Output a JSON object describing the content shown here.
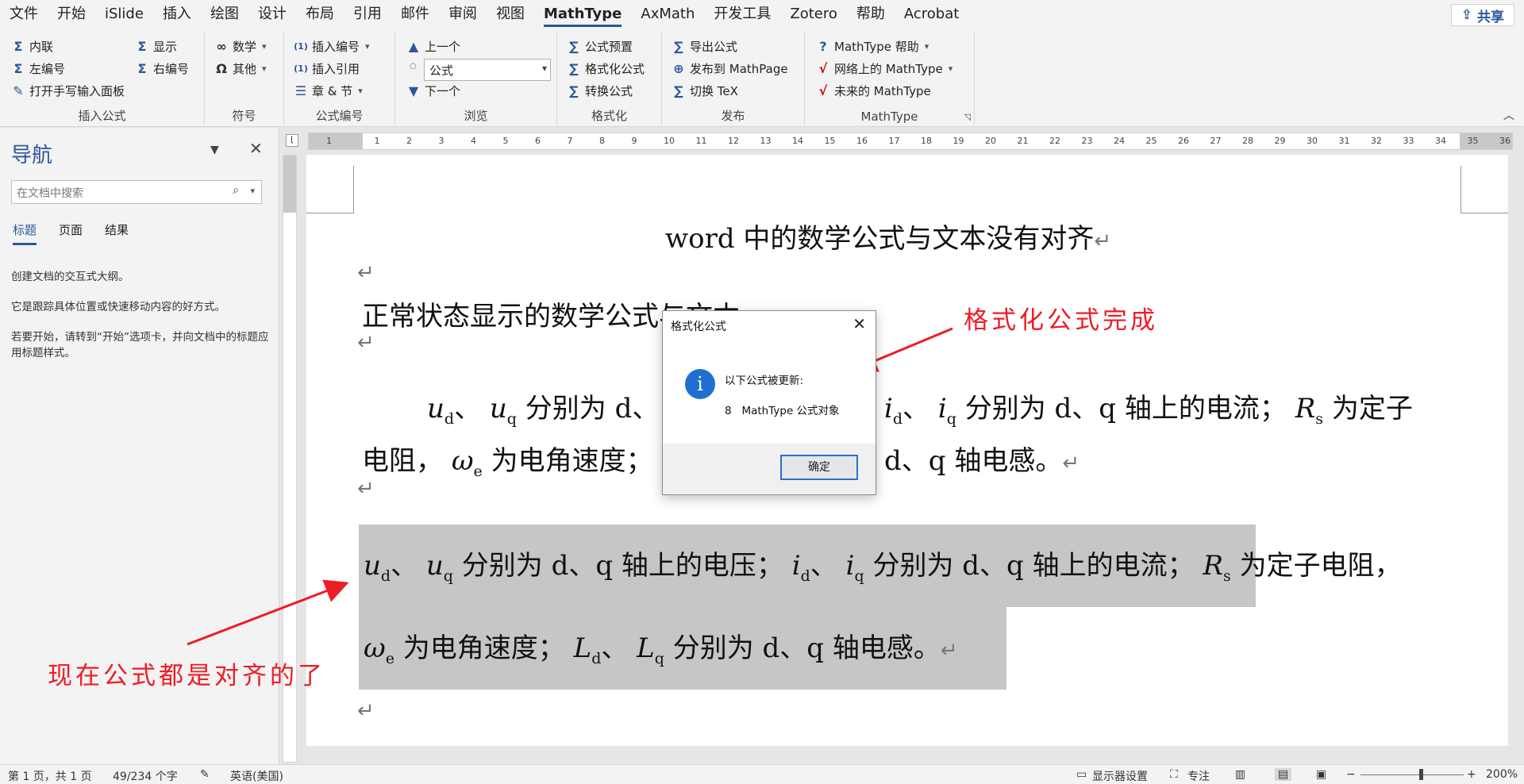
{
  "menu": {
    "items": [
      "文件",
      "开始",
      "iSlide",
      "插入",
      "绘图",
      "设计",
      "布局",
      "引用",
      "邮件",
      "审阅",
      "视图",
      "MathType",
      "AxMath",
      "开发工具",
      "Zotero",
      "帮助",
      "Acrobat"
    ],
    "active": "MathType",
    "share": "共享"
  },
  "ribbon": {
    "insert_eq": {
      "label": "插入公式",
      "inline": "内联",
      "display": "显示",
      "left_num": "左编号",
      "right_num": "右编号",
      "handwriting": "打开手写输入面板"
    },
    "symbols": {
      "label": "符号",
      "math": "数学",
      "other": "其他"
    },
    "numbering": {
      "label": "公式编号",
      "insert_num": "插入编号",
      "insert_ref": "插入引用",
      "chapter": "章 & 节"
    },
    "browse": {
      "label": "浏览",
      "prev": "上一个",
      "combo_value": "公式",
      "next": "下一个"
    },
    "format": {
      "label": "格式化",
      "preset": "公式预置",
      "format_eq": "格式化公式",
      "convert": "转换公式"
    },
    "publish": {
      "label": "发布",
      "export": "导出公式",
      "mathpage": "发布到 MathPage",
      "tex": "切换 TeX"
    },
    "mathtype": {
      "label": "MathType",
      "help": "MathType 帮助",
      "online": "网络上的 MathType",
      "future": "未来的 MathType"
    }
  },
  "nav": {
    "title": "导航",
    "search_placeholder": "在文档中搜索",
    "tabs": [
      "标题",
      "页面",
      "结果"
    ],
    "msg1": "创建文档的交互式大纲。",
    "msg2": "它是跟踪具体位置或快速移动内容的好方式。",
    "msg3": "若要开始，请转到“开始”选项卡，并向文档中的标题应用标题样式。"
  },
  "ruler": {
    "numbers": [
      "1",
      "1",
      "2",
      "3",
      "4",
      "5",
      "6",
      "7",
      "8",
      "9",
      "10",
      "11",
      "12",
      "13",
      "14",
      "15",
      "16",
      "17",
      "18",
      "19",
      "20",
      "21",
      "22",
      "23",
      "24",
      "25",
      "26",
      "27",
      "28",
      "29",
      "30",
      "31",
      "32",
      "33",
      "34",
      "35",
      "36"
    ]
  },
  "document": {
    "title": "word 中的数学公式与文本没有对齐",
    "para1": "正常状态显示的数学公式与文本",
    "p2_seg1": "分别为 d、",
    "p2_seg2": "分别为 d、q 轴上的电流；",
    "p2_seg3": "为定子",
    "p2_line2a": "电阻，",
    "p2_line2b": "为电角速度；",
    "p2_line2c": "d、q 轴电感。",
    "p3_line1a": "、",
    "p3_line1b": "分别为 d、q 轴上的电压；",
    "p3_line1c": "分别为 d、q 轴上的电流；",
    "p3_line1d": "为定子电阻，",
    "p3_line2a": "为电角速度；",
    "p3_line2b": "分别为 d、q 轴电感。",
    "sep": "、",
    "para_mark": "↵"
  },
  "annotations": {
    "top": "格式化公式完成",
    "bottom": "现在公式都是对齐的了",
    "color": "#ee1c24"
  },
  "dialog": {
    "title": "格式化公式",
    "message": "以下公式被更新:",
    "count": "8",
    "detail": "MathType 公式对象",
    "ok": "确定"
  },
  "status": {
    "page": "第 1 页，共 1 页",
    "words": "49/234 个字",
    "lang": "英语(美国)",
    "display_settings": "显示器设置",
    "focus": "专注",
    "zoom": "200%"
  }
}
